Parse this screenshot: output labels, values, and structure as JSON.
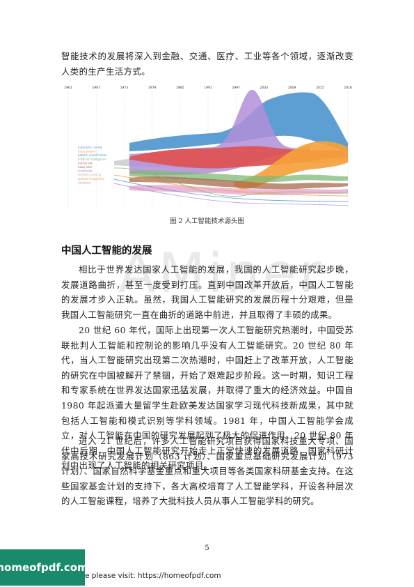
{
  "paragraphs": {
    "intro": "智能技术的发展将深入到金融、交通、医疗、工业等各个领域，逐渐改变人类的生产生活方式。",
    "p1": "相比于世界发达国家人工智能的发展，我国的人工智能研究起步晚，发展道路曲折，甚至一度受到打压。直到中国改革开放后，中国人工智能的发展才步入正轨。虽然，我国人工智能研究的发展历程十分艰难，但是我国人工智能研究一直在曲折的道路中前进，并且取得了丰硕的成果。",
    "p2": "20 世纪 60 年代，国际上出现第一次人工智能研究热潮时，中国受苏联批判人工智能和控制论的影响几乎没有人工智能研究。20 世纪 80 年代，当人工智能研究出现第二次热潮时，中国赶上了改革开放，人工智能的研究在中国被解开了禁锢，开始了艰难起步阶段。这一时期，知识工程和专家系统在世界发达国家迅猛发展，并取得了重大的经济效益。中国自 1980 年起派遣大量留学生赴欧美发达国家学习现代科技新成果，其中就包括人工智能和模式识别等学科领域。1981 年，中国人工智能学会成立，对人工智能在中国的研究发展起到了极大的促进作用。20 世纪 80 年代中后期，中国人工智能研究开始走上正常快速的发展道路，国家科研计划中出现了人工智能的相关研究项目。",
    "p3": "进入 21 世纪后，许多人工智能研究项目获得国家科技重大专项、国家高技术研究发展计划（863 计划）、国家重点基础研究发展计划（973 计划）、国家自然科学基金重点和重大项目等各类国家科研基金支持。在这些国家基金计划的支持下，各大高校培育了人工智能学科，开设各种层次的人工智能课程，培养了大批科技人员从事人工智能学科的研究。"
  },
  "figure": {
    "caption": "图 2  人工智能技术源头图",
    "years": [
      "1961",
      "1967",
      "1973",
      "1979",
      "1985",
      "1991",
      "1997",
      "2003",
      "2009",
      "2015",
      "2018"
    ],
    "stream_labels": [
      "automatic control",
      "fuzzy pattern",
      "pattern classification",
      "artificial intelligence",
      "neural net",
      "fuzzy sets",
      "knowledge",
      "theorem proving",
      "speech recognition",
      "database"
    ],
    "colors": {
      "blue": "#4f97cf",
      "purple": "#b08ed8",
      "red": "#e0504e",
      "orange": "#f5a13b",
      "green": "#7fb877",
      "brown": "#a56b4a",
      "pink": "#e58fc2",
      "gray": "#b5b5b5"
    }
  },
  "section": {
    "heading": "中国人工智能的发展"
  },
  "watermark": "AMiner",
  "page_number": "5",
  "footer": {
    "logo": "homeofpdf.com",
    "text": "e please visit: https://homeofpdf.com"
  }
}
